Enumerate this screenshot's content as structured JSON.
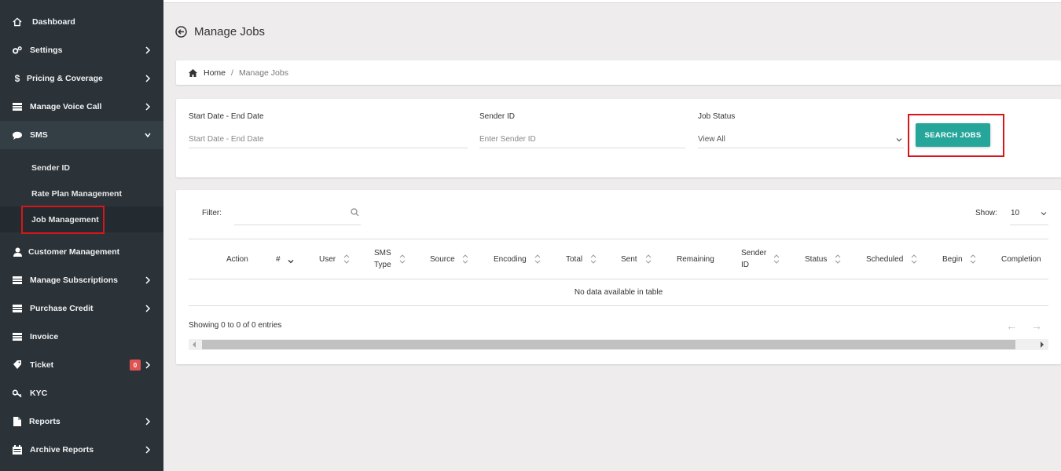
{
  "sidebar": {
    "items": [
      {
        "label": "Dashboard"
      },
      {
        "label": "Settings"
      },
      {
        "label": "Pricing & Coverage"
      },
      {
        "label": "Manage Voice Call"
      },
      {
        "label": "SMS"
      },
      {
        "label": "Customer Management"
      },
      {
        "label": "Manage Subscriptions"
      },
      {
        "label": "Purchase Credit"
      },
      {
        "label": "Invoice"
      },
      {
        "label": "Ticket",
        "badge": "0"
      },
      {
        "label": "KYC"
      },
      {
        "label": "Reports"
      },
      {
        "label": "Archive Reports"
      }
    ],
    "sms_sub": [
      {
        "label": "Sender ID"
      },
      {
        "label": "Rate Plan Management"
      },
      {
        "label": "Job Management"
      }
    ]
  },
  "page": {
    "title": "Manage Jobs"
  },
  "breadcrumb": {
    "home": "Home",
    "separator": "/",
    "current": "Manage Jobs"
  },
  "filters": {
    "date_label": "Start Date - End Date",
    "date_placeholder": "Start Date - End Date",
    "sender_label": "Sender ID",
    "sender_placeholder": "Enter Sender ID",
    "status_label": "Job Status",
    "status_value": "View All",
    "search_button": "SEARCH JOBS"
  },
  "table": {
    "filter_label": "Filter:",
    "show_label": "Show:",
    "show_value": "10",
    "columns": [
      "Action",
      "#",
      "User",
      "SMS Type",
      "Source",
      "Encoding",
      "Total",
      "Sent",
      "Remaining",
      "Sender ID",
      "Status",
      "Scheduled",
      "Begin",
      "Completion"
    ],
    "empty_text": "No data available in table",
    "info": "Showing 0 to 0 of 0 entries",
    "prev": "←",
    "next": "→"
  },
  "colors": {
    "sidebar_bg": "#2b3339",
    "accent": "#26a69a",
    "highlight": "#d6161b",
    "badge": "#e05353"
  }
}
